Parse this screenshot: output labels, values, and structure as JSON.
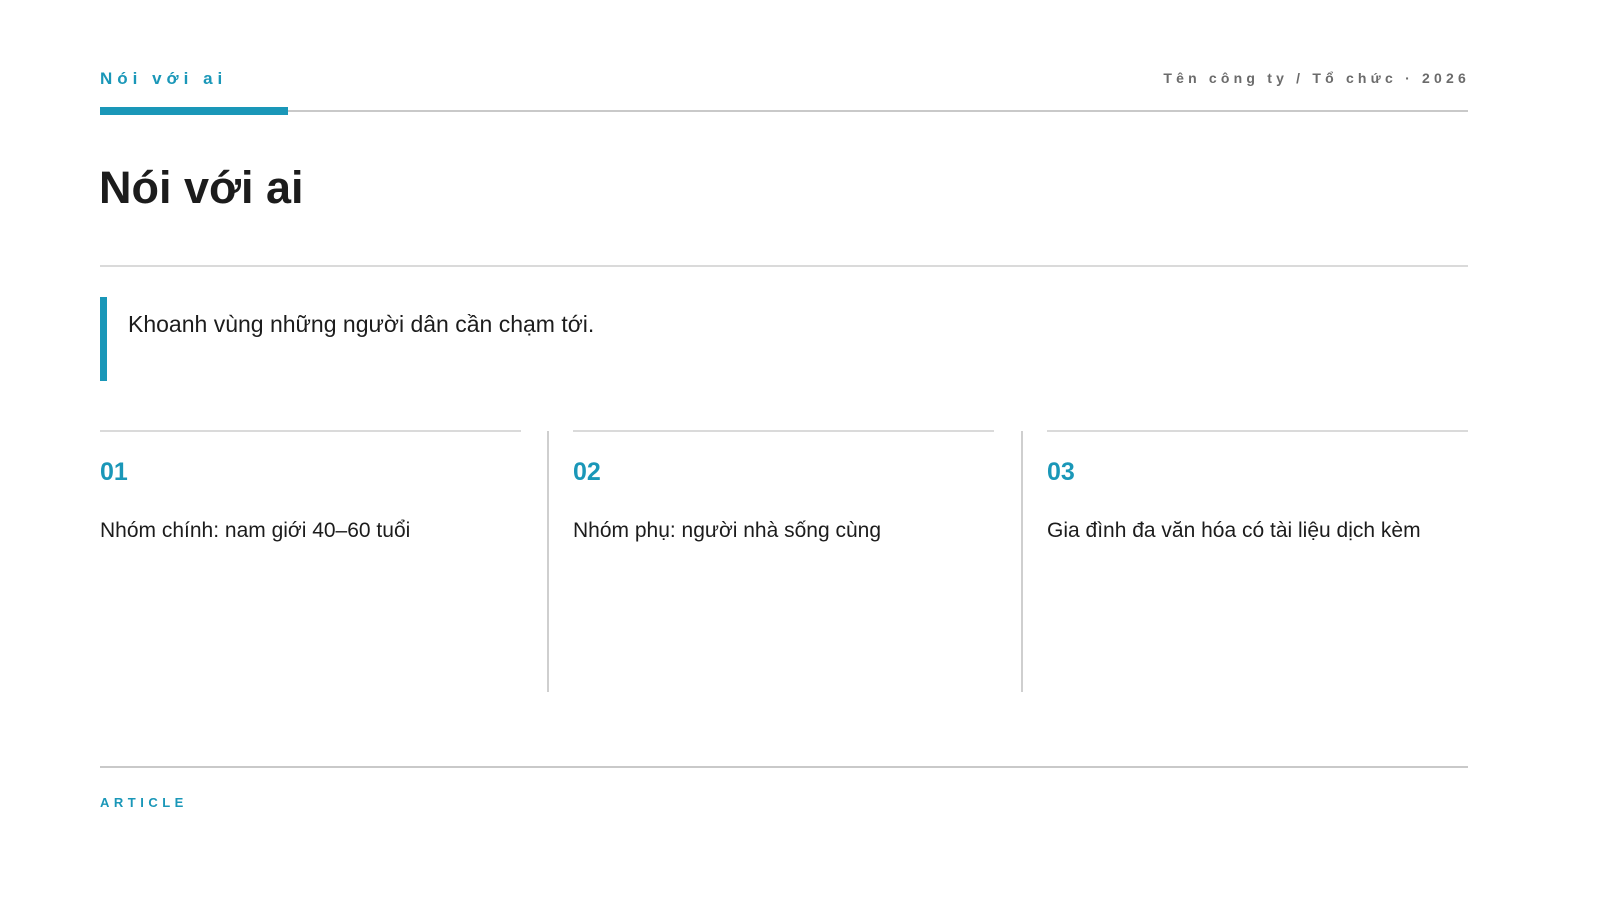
{
  "header": {
    "section_label": "Nói với ai",
    "meta": "Tên công ty / Tổ chức · 2026"
  },
  "page_title": "Nói với ai",
  "lead": "Khoanh vùng những người dân cần chạm tới.",
  "columns": [
    {
      "number": "01",
      "text": "Nhóm chính: nam giới 40–60 tuổi"
    },
    {
      "number": "02",
      "text": "Nhóm phụ: người nhà sống cùng"
    },
    {
      "number": "03",
      "text": "Gia đình đa văn hóa có tài liệu dịch kèm"
    }
  ],
  "footer": {
    "label": "ARTICLE"
  },
  "colors": {
    "accent": "#1a97b8",
    "text": "#1c1c1c",
    "muted": "#6b6b6b",
    "rule": "#c9c9c9"
  }
}
